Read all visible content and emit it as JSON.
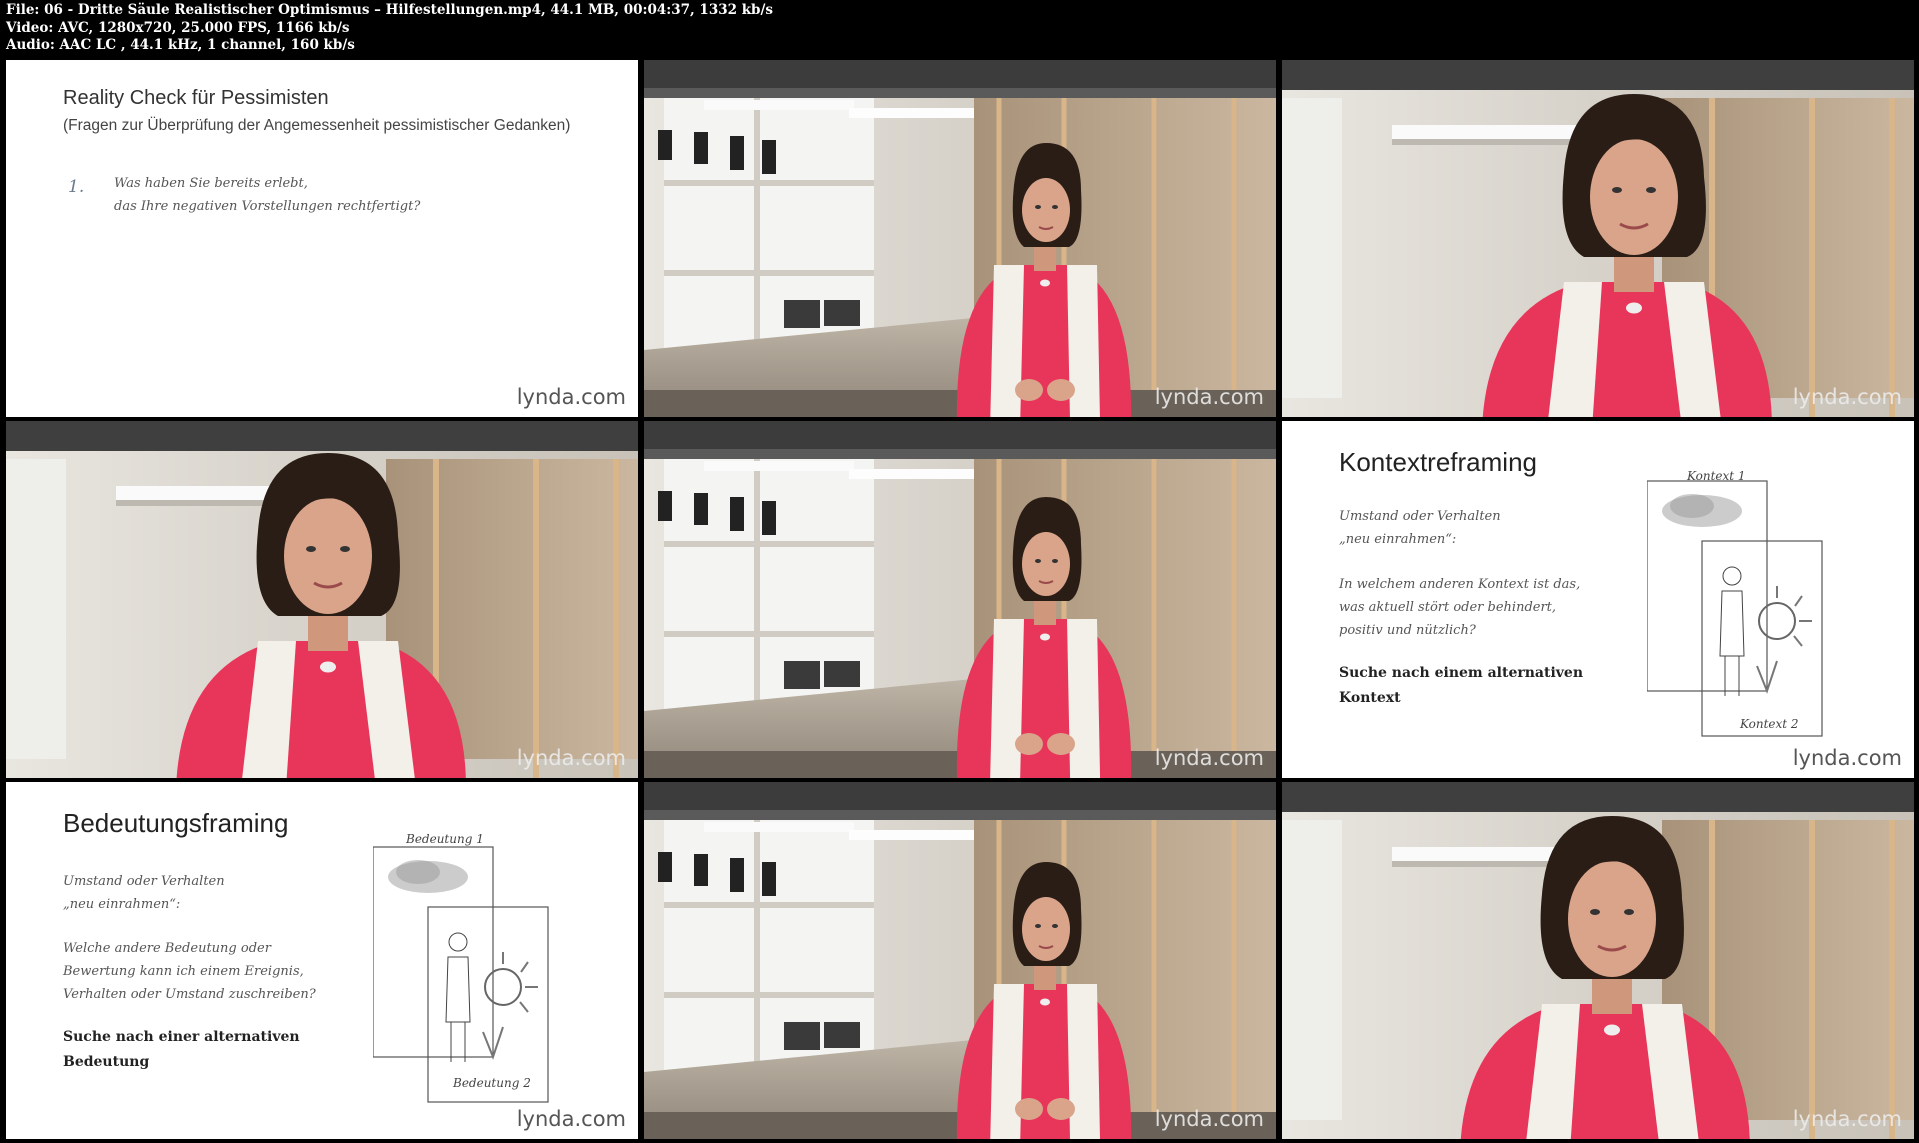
{
  "header": {
    "file_line": "File: 06 - Dritte Säule Realistischer Optimismus – Hilfestellungen.mp4, 44.1 MB, 00:04:37, 1332 kb/s",
    "video_line": "Video: AVC, 1280x720, 25.000 FPS, 1166 kb/s",
    "audio_line": "Audio: AAC LC , 44.1 kHz, 1 channel, 160 kb/s"
  },
  "watermark": "lynda.com",
  "slides": {
    "reality": {
      "title": "Reality Check für Pessimisten",
      "subtitle": "(Fragen zur Überprüfung der Angemessenheit pessimistischer Gedanken)",
      "number": "1.",
      "line1": "Was haben Sie bereits erlebt,",
      "line2": "das Ihre negativen Vorstellungen rechtfertigt?"
    },
    "kontext": {
      "title": "Kontextreframing",
      "p1_line1": "Umstand oder Verhalten",
      "p1_line2": "„neu einrahmen“:",
      "p2_line1": "In welchem anderen Kontext ist das,",
      "p2_line2": "was aktuell stört oder behindert,",
      "p2_line3": "positiv und nützlich?",
      "bold_line1": "Suche nach einem alternativen",
      "bold_line2": "Kontext",
      "sketch_top": "Kontext 1",
      "sketch_bottom": "Kontext 2"
    },
    "bedeutung": {
      "title": "Bedeutungsframing",
      "p1_line1": "Umstand oder Verhalten",
      "p1_line2": "„neu einrahmen“:",
      "p2_line1": "Welche andere Bedeutung  oder",
      "p2_line2": "Bewertung kann ich einem Ereignis,",
      "p2_line3": "Verhalten oder Umstand zuschreiben?",
      "bold_line1": "Suche nach einer alternativen",
      "bold_line2": "Bedeutung",
      "sketch_top": "Bedeutung 1",
      "sketch_bottom": "Bedeutung 2"
    }
  },
  "colors": {
    "dress": "#e8365a",
    "scarf": "#f3efe9",
    "hair": "#2a1d16",
    "skin": "#d9a48a",
    "wall": "#d8d4cc",
    "ceiling": "#3a3a3a"
  }
}
